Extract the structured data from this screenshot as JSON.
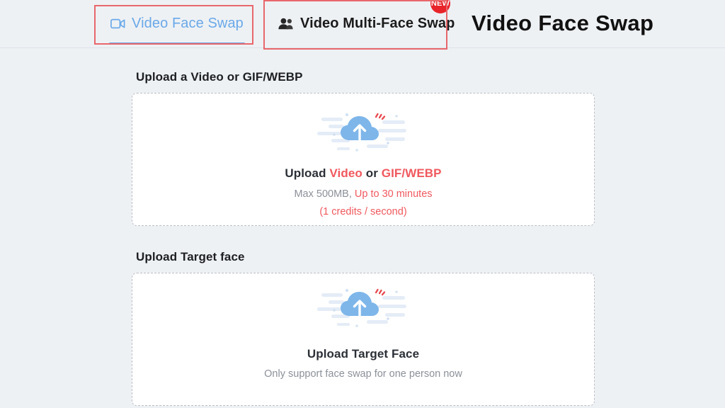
{
  "header": {
    "title": "Video Face Swap",
    "tabs": [
      {
        "id": "video-face-swap",
        "label": "Video Face Swap",
        "icon": "video-camera-icon",
        "active": true,
        "badge": null
      },
      {
        "id": "video-multi-face-swap",
        "label": "Video Multi-Face Swap",
        "icon": "users-icon",
        "active": false,
        "badge": "NEW"
      }
    ]
  },
  "main": {
    "sections": [
      {
        "id": "upload-video",
        "heading": "Upload a Video or GIF/WEBP",
        "dropzone": {
          "icon": "cloud-upload-icon",
          "line1_prefix": "Upload ",
          "line1_highlight1": "Video",
          "line1_middle": " or ",
          "line1_highlight2": "GIF/WEBP",
          "line2_prefix": "Max 500MB, ",
          "line2_highlight": "Up to 30 minutes",
          "line3": "(1 credits / second)"
        }
      },
      {
        "id": "upload-target-face",
        "heading": "Upload Target face",
        "dropzone": {
          "icon": "cloud-upload-icon",
          "line1": "Upload Target Face",
          "subtext": "Only support face swap for one person now"
        }
      }
    ]
  },
  "colors": {
    "page_background": "#eef1f4",
    "accent_blue": "#6aa9e9",
    "accent_red": "#f0595e",
    "badge_red": "#e8242a",
    "annotation_red": "#e8676b",
    "text_dark": "#1d1f23",
    "text_muted": "#8b9099",
    "dropzone_background": "#ffffff",
    "dropzone_border": "#b9bec6"
  }
}
